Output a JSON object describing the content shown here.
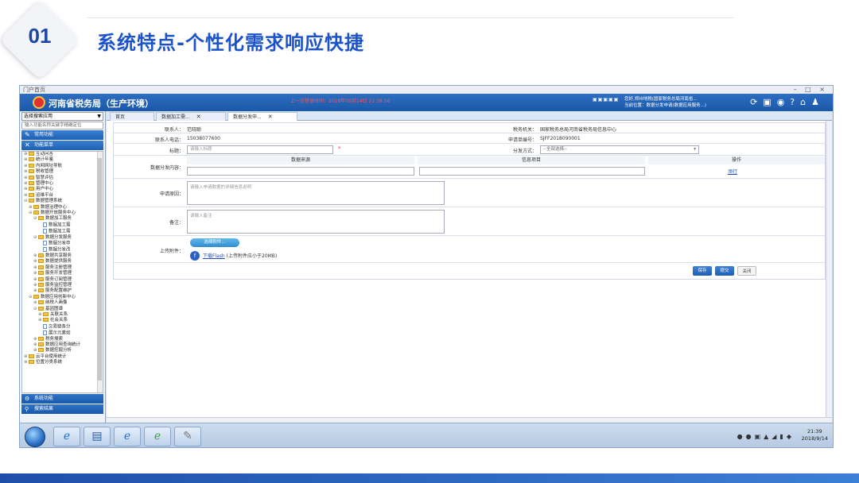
{
  "slide": {
    "number": "01",
    "title": "系统特点-个性化需求响应快捷"
  },
  "window": {
    "titlebar": "门户首页",
    "controls": "– □ ×"
  },
  "app": {
    "title": "河南省税务局（生产环境）",
    "red_notice": "上一次登录时间：2018年09月14日 21:38:56",
    "info_line1": "您好,郑州地税(国家税务总局河南省...",
    "info_line2": "当前位置：数据分发申请(数据应用服务...)",
    "header_icons": [
      "refresh-icon",
      "screen-icon",
      "eye-icon",
      "help-icon",
      "home-icon",
      "user-icon"
    ]
  },
  "sidebar": {
    "select_value": "选择搜索应用",
    "search_placeholder": "输入功能名称关键字精确定位",
    "common_functions": "常用功能",
    "function_menu": "功能菜单",
    "tree": [
      {
        "pm": "⊕",
        "type": "fld",
        "indent": 0,
        "label": "互动问答"
      },
      {
        "pm": "⊕",
        "type": "fld",
        "indent": 0,
        "label": "统计年鉴"
      },
      {
        "pm": "⊕",
        "type": "fld",
        "indent": 0,
        "label": "内网网址导航"
      },
      {
        "pm": "⊕",
        "type": "fld",
        "indent": 0,
        "label": "税收管理"
      },
      {
        "pm": "⊕",
        "type": "fld",
        "indent": 0,
        "label": "智慧评估"
      },
      {
        "pm": "⊕",
        "type": "fld",
        "indent": 0,
        "label": "管理中心"
      },
      {
        "pm": "⊕",
        "type": "fld",
        "indent": 0,
        "label": "用户中心"
      },
      {
        "pm": "⊕",
        "type": "fld",
        "indent": 0,
        "label": "运维平台"
      },
      {
        "pm": "⊖",
        "type": "fld",
        "indent": 0,
        "label": "数据管理系统"
      },
      {
        "pm": "⊕",
        "type": "fld",
        "indent": 1,
        "label": "数据治理中心"
      },
      {
        "pm": "⊖",
        "type": "fld",
        "indent": 1,
        "label": "数据开放服务中心"
      },
      {
        "pm": "⊖",
        "type": "fld",
        "indent": 2,
        "label": "数据加工服务"
      },
      {
        "pm": "",
        "type": "doc",
        "indent": 3,
        "label": "数据加工需"
      },
      {
        "pm": "",
        "type": "doc",
        "indent": 3,
        "label": "数据加工需"
      },
      {
        "pm": "⊖",
        "type": "fld",
        "indent": 2,
        "label": "数据分发服务"
      },
      {
        "pm": "",
        "type": "doc",
        "indent": 3,
        "label": "数据分发申"
      },
      {
        "pm": "",
        "type": "doc",
        "indent": 3,
        "label": "数据分发改"
      },
      {
        "pm": "⊕",
        "type": "fld",
        "indent": 2,
        "label": "数据共享服务"
      },
      {
        "pm": "⊕",
        "type": "fld",
        "indent": 2,
        "label": "数据提供服务"
      },
      {
        "pm": "⊕",
        "type": "fld",
        "indent": 2,
        "label": "服务注册管理"
      },
      {
        "pm": "⊕",
        "type": "fld",
        "indent": 2,
        "label": "服务开发管理"
      },
      {
        "pm": "⊕",
        "type": "fld",
        "indent": 2,
        "label": "服务订阅管理"
      },
      {
        "pm": "⊕",
        "type": "fld",
        "indent": 2,
        "label": "服务监控管理"
      },
      {
        "pm": "⊕",
        "type": "fld",
        "indent": 2,
        "label": "服务配置维护"
      },
      {
        "pm": "⊖",
        "type": "fld",
        "indent": 1,
        "label": "数据应用创新中心"
      },
      {
        "pm": "⊕",
        "type": "fld",
        "indent": 2,
        "label": "纳税人画像"
      },
      {
        "pm": "⊖",
        "type": "fld",
        "indent": 2,
        "label": "基因图谱"
      },
      {
        "pm": "⊕",
        "type": "fld",
        "indent": 3,
        "label": "关联关系"
      },
      {
        "pm": "⊕",
        "type": "fld",
        "indent": 3,
        "label": "社会关系"
      },
      {
        "pm": "",
        "type": "doc",
        "indent": 3,
        "label": "交易链条分"
      },
      {
        "pm": "",
        "type": "doc",
        "indent": 3,
        "label": "展示元素如"
      },
      {
        "pm": "⊕",
        "type": "fld",
        "indent": 2,
        "label": "税务搜索"
      },
      {
        "pm": "⊕",
        "type": "fld",
        "indent": 2,
        "label": "数据应用查询统计"
      },
      {
        "pm": "⊕",
        "type": "fld",
        "indent": 2,
        "label": "数据挖掘分析"
      },
      {
        "pm": "⊕",
        "type": "fld",
        "indent": 0,
        "label": "云平台使用统计"
      },
      {
        "pm": "⊕",
        "type": "fld",
        "indent": 0,
        "label": "位置分类系统"
      }
    ],
    "system_functions": "系统功能",
    "search_results": "搜索结果"
  },
  "tabs": [
    {
      "label": "首页",
      "closable": false,
      "active": false
    },
    {
      "label": "数据加工需...",
      "closable": true,
      "active": false
    },
    {
      "label": "数据分发申...",
      "closable": true,
      "active": true
    }
  ],
  "form": {
    "contact_label": "联系人：",
    "contact_value": "范晓聪",
    "tax_org_label": "税务机关：",
    "tax_org_value": "国家税务总局河南省税务局信息中心",
    "phone_label": "联系人电话：",
    "phone_value": "15038077600",
    "apply_no_label": "申请单编号：",
    "apply_no_value": "SJFF2018090001",
    "title_label": "标题：",
    "title_placeholder": "请输入标题",
    "required_mark": "*",
    "method_label": "分发方式：",
    "method_value": "--全部选择--",
    "content_label": "数据分发内容：",
    "col_source": "数据来源",
    "col_item": "信息项目",
    "col_action": "操作",
    "action_link": "添行",
    "reason_label": "申请原因：",
    "reason_placeholder": "请输入申请数据的详细信息说明",
    "remark_label": "备注：",
    "remark_placeholder": "请输入备注",
    "attach_label": "上传附件：",
    "upload_btn": "选择附件...",
    "download_flash": "下载Flash",
    "flash_note": "(上传附件应小于20MB)",
    "save_btn": "保存",
    "submit_btn": "提交",
    "close_btn": "关闭"
  },
  "taskbar": {
    "time": "21:39",
    "date": "2018/9/14"
  }
}
